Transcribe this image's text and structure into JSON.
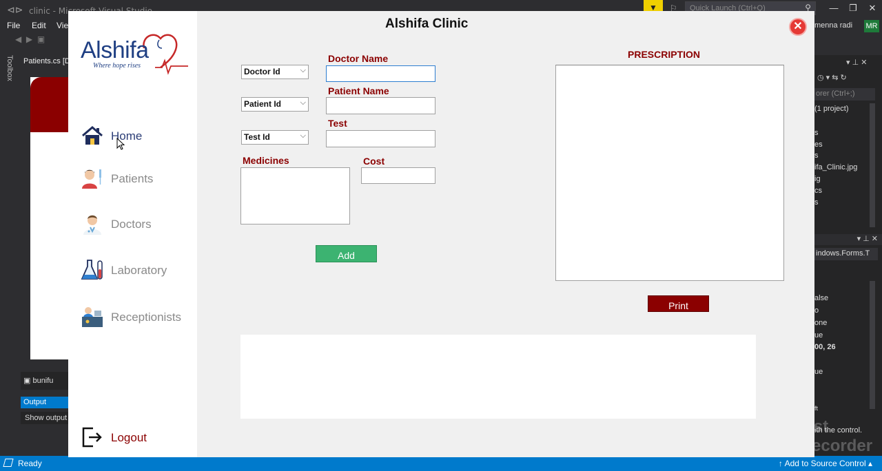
{
  "vs": {
    "title": "clinic - Microsoft Visual Studio",
    "menu": [
      "File",
      "Edit",
      "Vie"
    ],
    "quick_launch": "Quick Launch (Ctrl+Q)",
    "user": "menna radi",
    "avatar": "MR",
    "toolbox": "Toolbox",
    "doc_tab": "Patients.cs [D",
    "tray_tab": "bunifu",
    "output_tab": "Output",
    "output_show": "Show output",
    "solution_search": "orer (Ctrl+;)",
    "solution_project": "(1 project)",
    "solution_items": [
      "s",
      "es",
      "s",
      "ifa_Clinic.jpg",
      "ig",
      "cs",
      "s"
    ],
    "props_combo": "indows.Forms.T",
    "props_values": [
      "alse",
      "o",
      "one",
      "ue",
      "00, 26",
      "ue",
      "ft"
    ],
    "props_desc": "ith the control.",
    "status_ready": "Ready",
    "status_source": "Add to Source Control",
    "watermark": "Screencast Screen Recorder"
  },
  "app": {
    "title": "Alshifa Clinic",
    "close_glyph": "✕",
    "logo": {
      "name": "Alshifa",
      "tagline": "Where hope rises"
    }
  },
  "nav": {
    "home": "Home",
    "patients": "Patients",
    "doctors": "Doctors",
    "laboratory": "Laboratory",
    "receptionists": "Receptionists",
    "logout": "Logout"
  },
  "form": {
    "doctor_id": "Doctor Id",
    "patient_id": "Patient Id",
    "test_id": "Test Id",
    "doctor_name_label": "Doctor Name",
    "patient_name_label": "Patient Name",
    "test_label": "Test",
    "medicines_label": "Medicines",
    "cost_label": "Cost",
    "doctor_name_value": "",
    "patient_name_value": "",
    "test_value": "",
    "medicines_value": "",
    "cost_value": "",
    "add_button": "Add",
    "prescription_title": "PRESCRIPTION",
    "print_button": "Print"
  },
  "colors": {
    "accent_red": "#8b0000",
    "add_green": "#3cb371",
    "vs_blue": "#007acc"
  }
}
